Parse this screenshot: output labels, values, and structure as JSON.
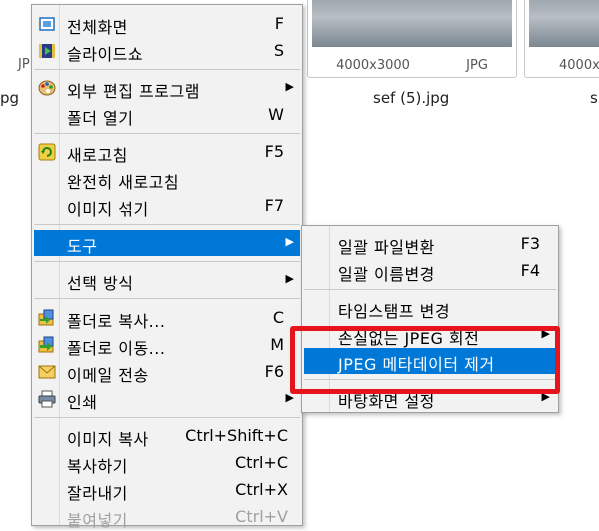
{
  "background": {
    "thumbs": [
      {
        "size": "4000x3000",
        "format": "JPG",
        "filename": "sef (5).jpg"
      },
      {
        "size": "4000x",
        "format": "",
        "filename": "s"
      }
    ],
    "left_partial_format": "JP",
    "left_partial_filename": "pg"
  },
  "context_menu": {
    "items": [
      {
        "label": "전체화면",
        "shortcut": "F",
        "icon": "fullscreen-icon"
      },
      {
        "label": "슬라이드쇼",
        "shortcut": "S",
        "icon": "slideshow-icon"
      },
      {
        "label": "외부 편집 프로그램",
        "shortcut": "",
        "icon": "palette-icon"
      },
      {
        "label": "폴더 열기",
        "shortcut": "W"
      },
      {
        "label": "새로고침",
        "shortcut": "F5",
        "icon": "refresh-icon"
      },
      {
        "label": "완전히 새로고침",
        "shortcut": ""
      },
      {
        "label": "이미지 섞기",
        "shortcut": "F7"
      },
      {
        "label": "도구",
        "shortcut": ""
      },
      {
        "label": "선택 방식",
        "shortcut": ""
      },
      {
        "label": "폴더로 복사...",
        "shortcut": "C",
        "icon": "copy-to-folder-icon"
      },
      {
        "label": "폴더로 이동...",
        "shortcut": "M",
        "icon": "move-to-folder-icon"
      },
      {
        "label": "이메일 전송",
        "shortcut": "F6",
        "icon": "email-icon"
      },
      {
        "label": "인쇄",
        "shortcut": "",
        "icon": "printer-icon"
      },
      {
        "label": "이미지 복사",
        "shortcut": "Ctrl+Shift+C"
      },
      {
        "label": "복사하기",
        "shortcut": "Ctrl+C"
      },
      {
        "label": "잘라내기",
        "shortcut": "Ctrl+X"
      },
      {
        "label": "붙여넣기",
        "shortcut": "Ctrl+V"
      }
    ]
  },
  "tools_submenu": {
    "items": [
      {
        "label": "일괄 파일변환",
        "shortcut": "F3"
      },
      {
        "label": "일괄 이름변경",
        "shortcut": "F4"
      },
      {
        "label": "타임스탬프 변경",
        "shortcut": ""
      },
      {
        "label": "손실없는 JPEG 회전",
        "shortcut": ""
      },
      {
        "label": "JPEG 메타데이터 제거",
        "shortcut": ""
      },
      {
        "label": "바탕화면 설정",
        "shortcut": ""
      }
    ]
  },
  "colors": {
    "highlight": "#0078d7",
    "annotation": "#e8141c"
  }
}
